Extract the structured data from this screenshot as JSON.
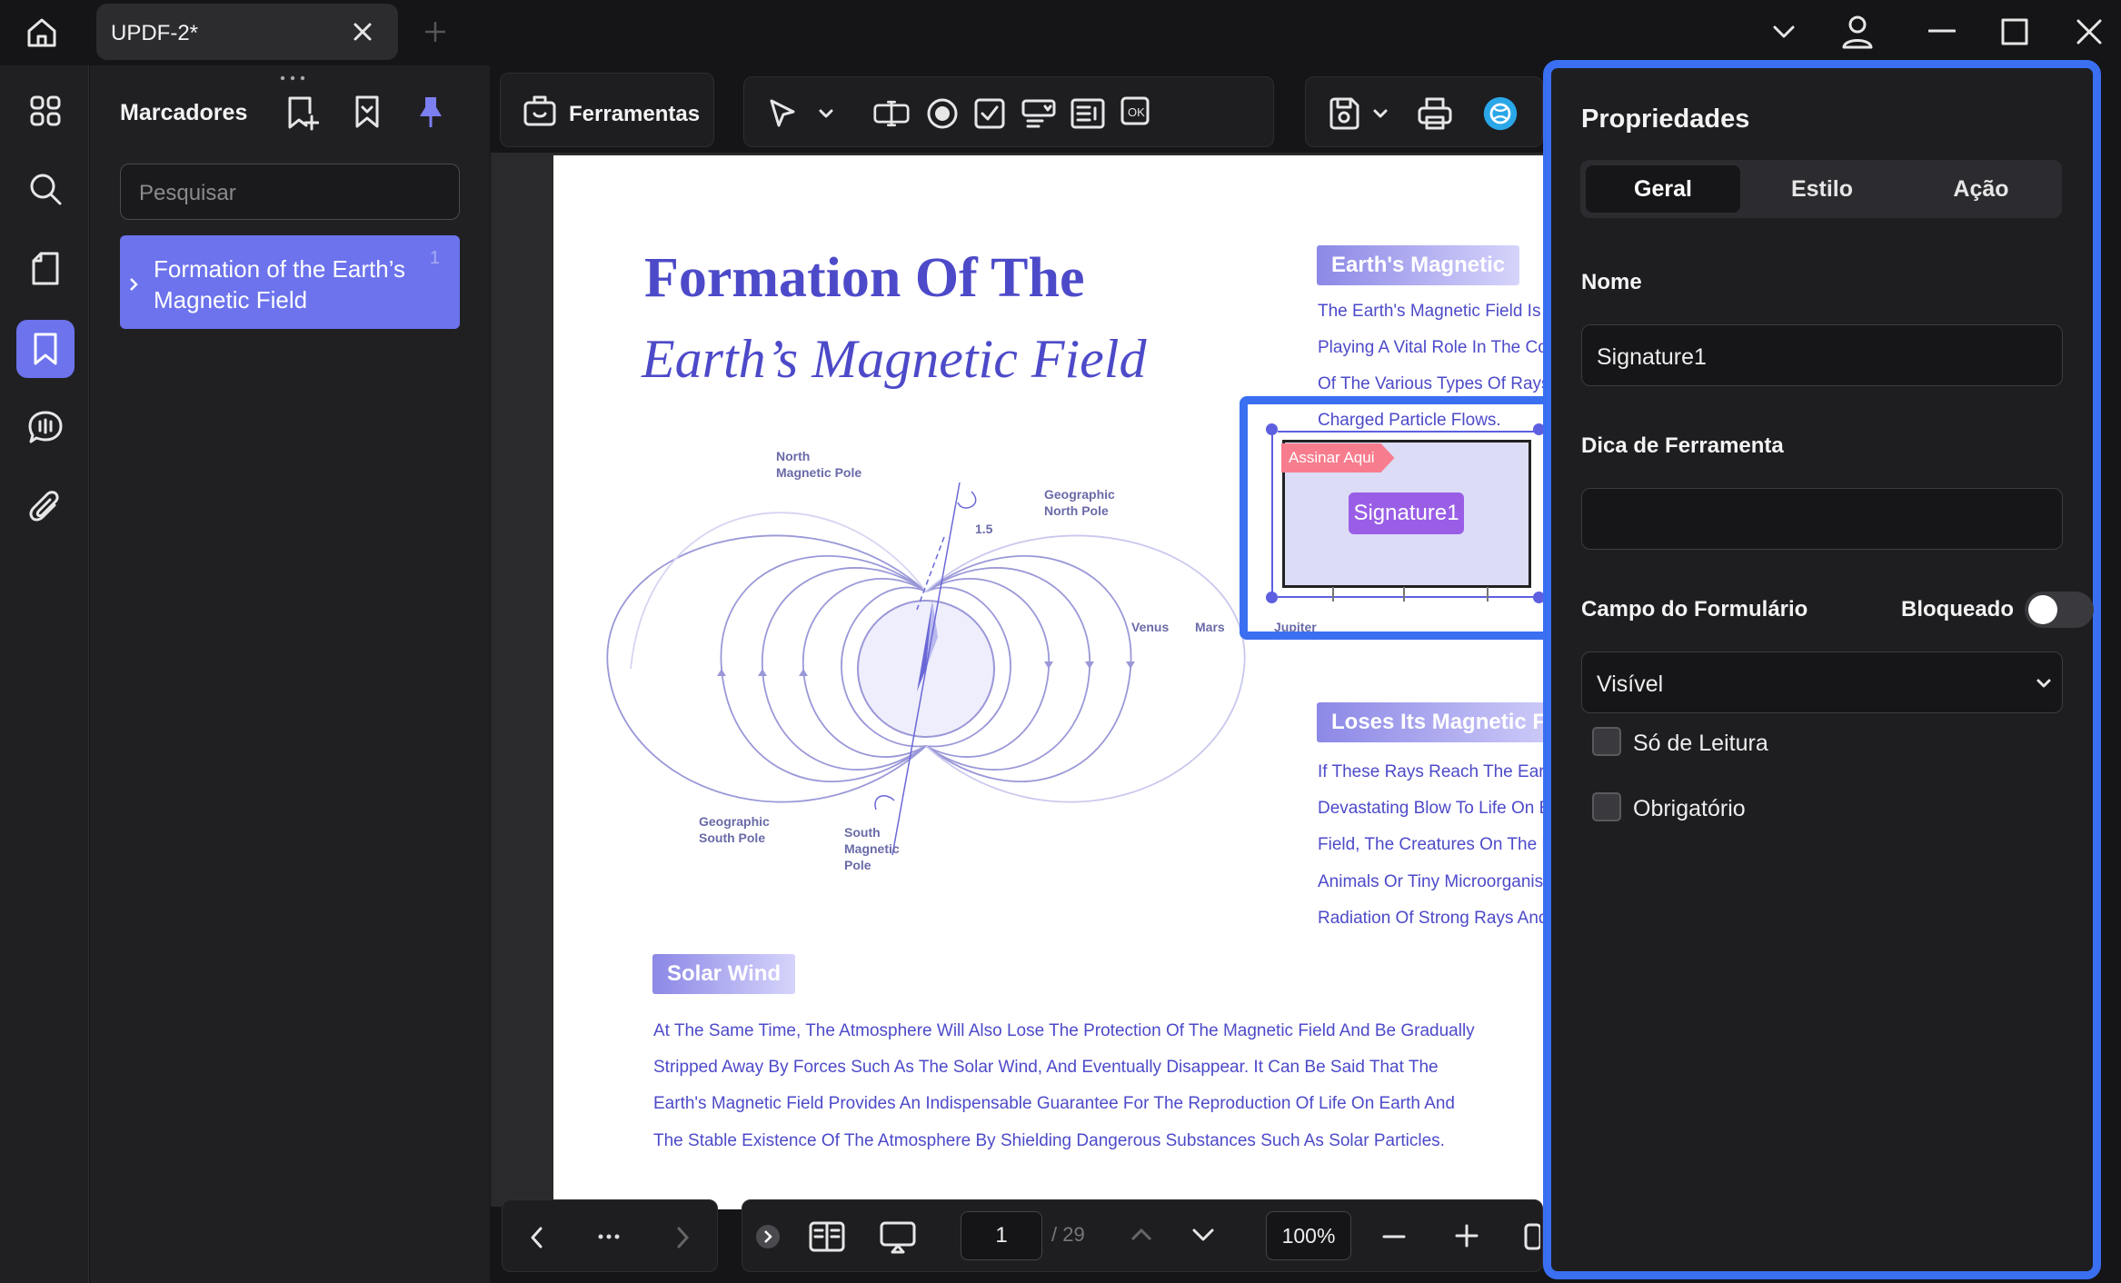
{
  "app": {
    "tab_title": "UPDF-2*"
  },
  "bookmarks": {
    "title": "Marcadores",
    "search_placeholder": "Pesquisar",
    "items": [
      {
        "label": "Formation of the Earth’s Magnetic Field",
        "page": "1"
      }
    ]
  },
  "toolbar": {
    "tools_label": "Ferramentas"
  },
  "document": {
    "title_line1": "Formation Of The",
    "title_line2": "Earth’s Magnetic Field",
    "badge_magnetic": "Earth's Magnetic",
    "magnetic_lines": [
      "The Earth's Magnetic Field Is",
      "Playing A Vital Role In The Co",
      "Of The Various Types Of Rays",
      "Charged Particle Flows."
    ],
    "badge_loses": "Loses Its Magnetic Fiel",
    "loses_lines": [
      "If These Rays Reach The Ear",
      "Devastating Blow To Life On E",
      "Field, The Creatures On The E",
      "Animals Or Tiny Microorganis",
      "Radiation Of Strong Rays And"
    ],
    "badge_solar": "Solar Wind",
    "solar_lines": [
      "At The Same Time, The Atmosphere Will Also Lose The Protection Of The Magnetic Field And Be Gradually",
      "Stripped Away By Forces Such As The Solar Wind, And Eventually Disappear. It Can Be Said That The",
      "Earth's Magnetic Field Provides An Indispensable Guarantee For The Reproduction Of Life On Earth And",
      "The Stable Existence Of The Atmosphere By Shielding Dangerous Substances Such As Solar Particles."
    ],
    "diagram": {
      "north_magnetic": "North\nMagnetic Pole",
      "geo_north": "Geographic\nNorth Pole",
      "geo_south": "Geographic\nSouth Pole",
      "south_magnetic": "South\nMagnetic\nPole",
      "angle": "1.5"
    },
    "chart_labels": [
      "Venus",
      "Mars",
      "Jupiter"
    ]
  },
  "signature": {
    "assign_label": "Assinar Aqui",
    "field_name": "Signature1"
  },
  "pagination": {
    "current": "1",
    "total": "/ 29",
    "zoom": "100%"
  },
  "properties": {
    "title": "Propriedades",
    "tabs": [
      "Geral",
      "Estilo",
      "Ação"
    ],
    "name_label": "Nome",
    "name_value": "Signature1",
    "tooltip_label": "Dica de Ferramenta",
    "tooltip_value": "",
    "form_field_label": "Campo do Formulário",
    "locked_label": "Bloqueado",
    "locked": false,
    "visibility_value": "Visível",
    "readonly_label": "Só de Leitura",
    "required_label": "Obrigatório"
  }
}
